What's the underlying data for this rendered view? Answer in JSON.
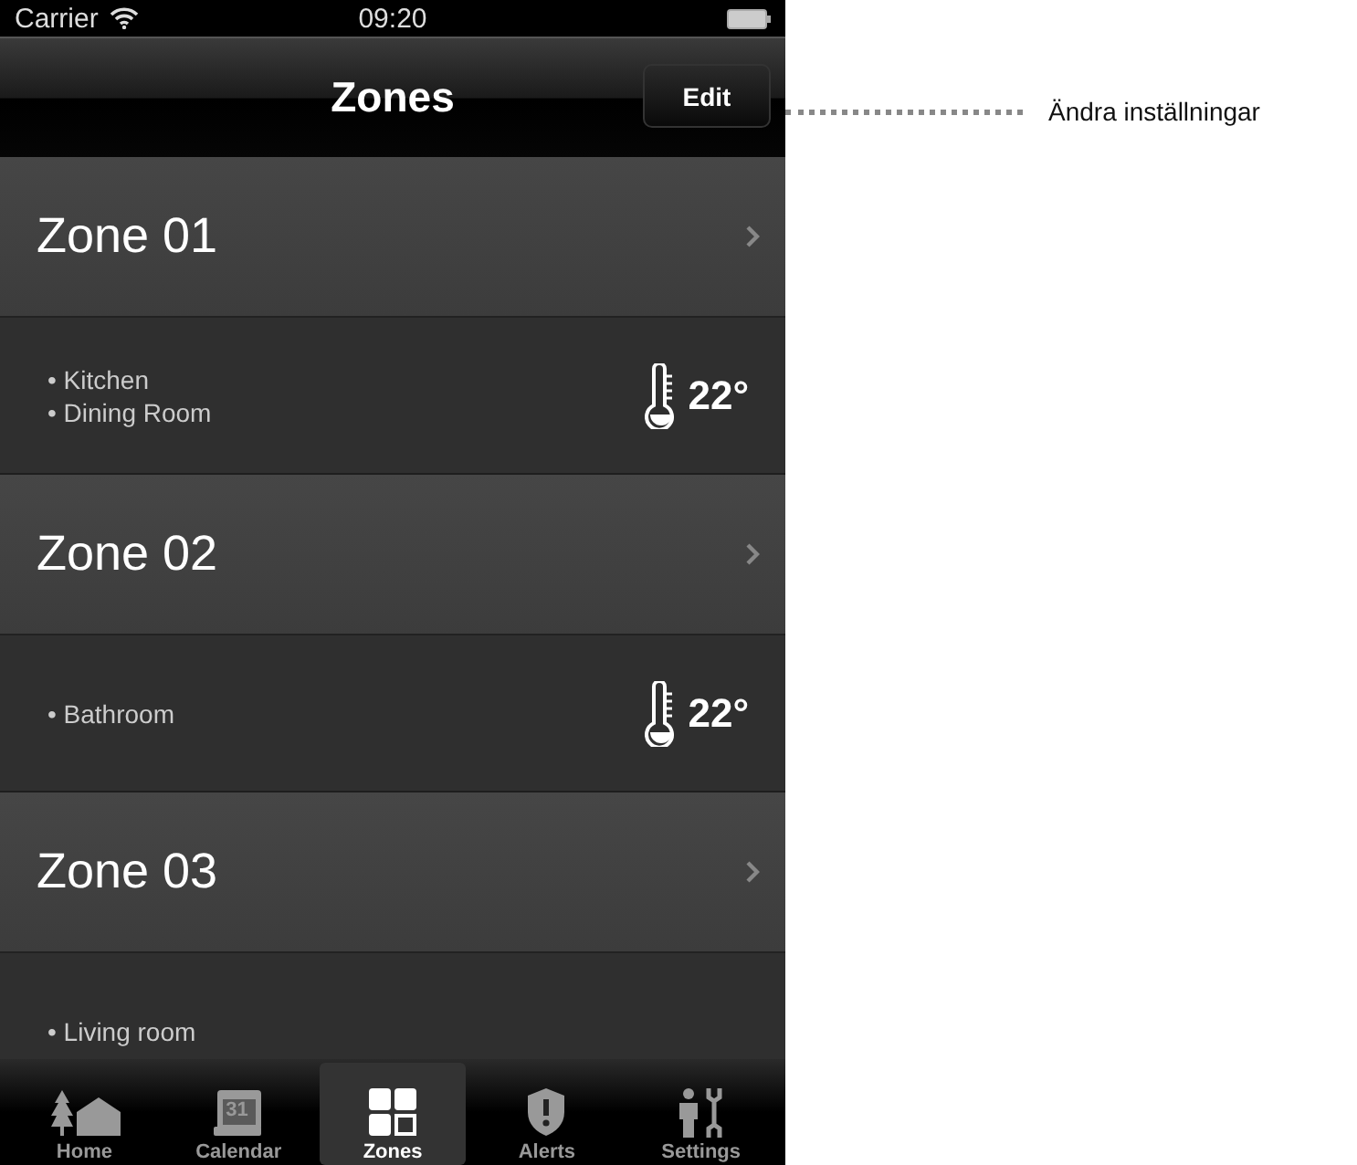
{
  "status_bar": {
    "carrier": "Carrier",
    "time": "09:20"
  },
  "nav_bar": {
    "title": "Zones",
    "edit_button": "Edit"
  },
  "zones": [
    {
      "name": "Zone 01",
      "rooms": [
        "• Kitchen",
        "• Dining Room"
      ],
      "temperature": "22°"
    },
    {
      "name": "Zone 02",
      "rooms": [
        "• Bathroom"
      ],
      "temperature": "22°"
    },
    {
      "name": "Zone 03",
      "rooms": [
        "• Living room"
      ]
    }
  ],
  "tab_bar": [
    {
      "kind": "home",
      "label": "Home",
      "selected": false
    },
    {
      "kind": "calendar",
      "label": "Calendar",
      "icon_text": "31",
      "selected": false
    },
    {
      "kind": "zones",
      "label": "Zones",
      "selected": true
    },
    {
      "kind": "alerts",
      "label": "Alerts",
      "selected": false
    },
    {
      "kind": "settings",
      "label": "Settings",
      "selected": false
    }
  ],
  "annotation": {
    "text": "Ändra inställningar"
  }
}
